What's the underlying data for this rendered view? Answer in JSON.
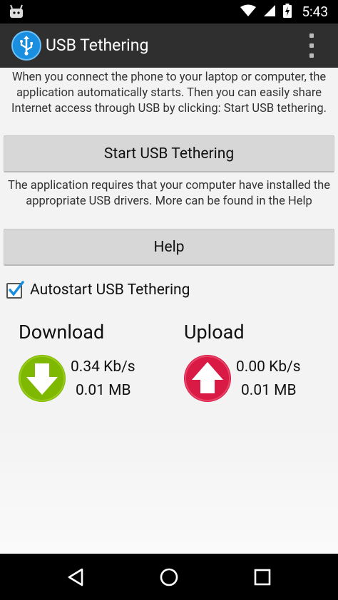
{
  "status_bar": {
    "time": "5:43",
    "icons": [
      "android-icon",
      "wifi-icon",
      "signal-icon",
      "battery-charging-icon"
    ]
  },
  "app_bar": {
    "title": "USB Tethering",
    "icon": "usb-icon",
    "menu_icon": "overflow-menu-icon"
  },
  "main": {
    "description": "When you connect the phone to your laptop or computer, the application automatically starts. Then you can easily share Internet access through USB by clicking: Start USB tethering.",
    "start_button": "Start USB Tethering",
    "driver_note": "The application requires that your computer have installed the appropriate USB drivers. More can be found in the Help",
    "help_button": "Help",
    "autostart": {
      "label": "Autostart USB Tethering",
      "checked": true
    }
  },
  "stats": {
    "download": {
      "title": "Download",
      "rate": "0.34 Kb/s",
      "total": "0.01 MB",
      "color": "#7fb800",
      "icon": "arrow-down-icon"
    },
    "upload": {
      "title": "Upload",
      "rate": "0.00 Kb/s",
      "total": "0.01 MB",
      "color": "#d91a44",
      "icon": "arrow-up-icon"
    }
  },
  "nav_bar": {
    "buttons": [
      "back-icon",
      "home-icon",
      "recents-icon"
    ]
  },
  "colors": {
    "accent": "#1a8fe0",
    "app_bar": "#2f2f2f"
  }
}
